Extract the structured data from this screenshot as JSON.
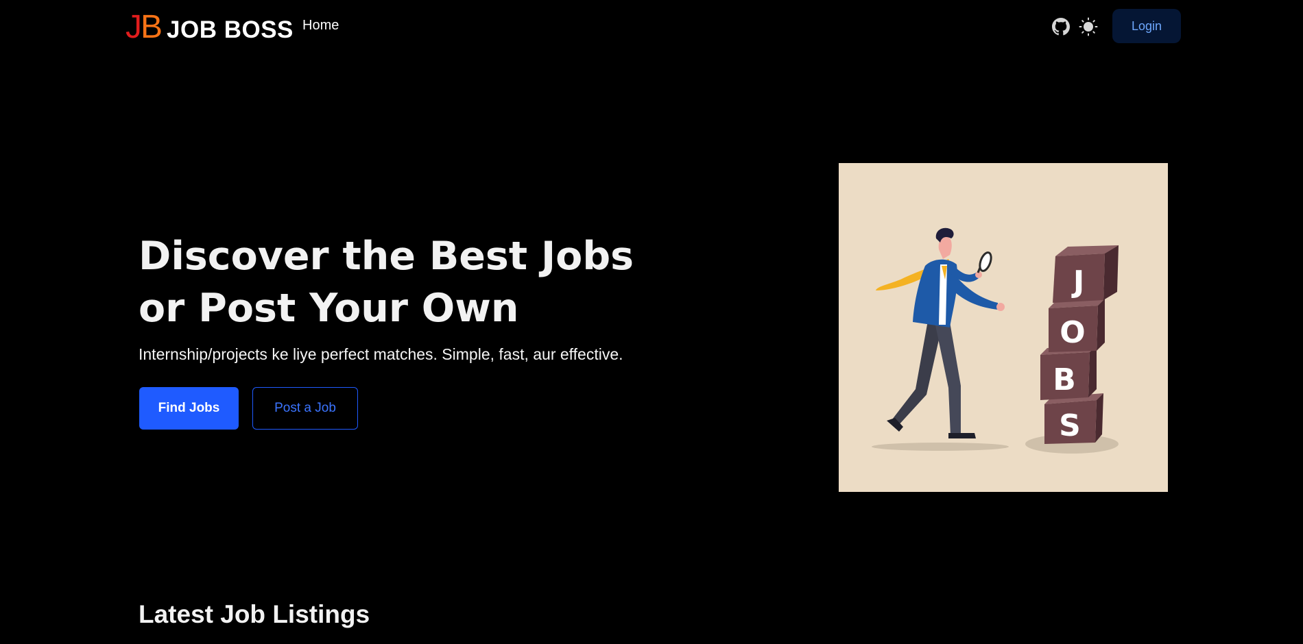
{
  "brand": {
    "logo_j": "J",
    "logo_b": "B",
    "name": "JOB BOSS",
    "colors": {
      "j": "#e11d1d",
      "b": "#f97316"
    }
  },
  "nav": {
    "links": [
      {
        "label": "Home"
      }
    ],
    "icons": {
      "github": "github-icon",
      "theme": "sun-icon"
    },
    "login_label": "Login"
  },
  "hero": {
    "title_line1": "Discover the Best Jobs",
    "title_line2": "or Post Your Own",
    "subtitle": "Internship/projects ke liye perfect matches. Simple, fast, aur effective.",
    "primary_button": "Find Jobs",
    "secondary_button": "Post a Job",
    "illustration": {
      "blocks": [
        "J",
        "O",
        "B",
        "S"
      ],
      "background": "#ecdcc5"
    }
  },
  "latest": {
    "title": "Latest Job Listings"
  },
  "colors": {
    "background": "#000000",
    "accent": "#1f5bff",
    "login_bg": "#051634"
  }
}
